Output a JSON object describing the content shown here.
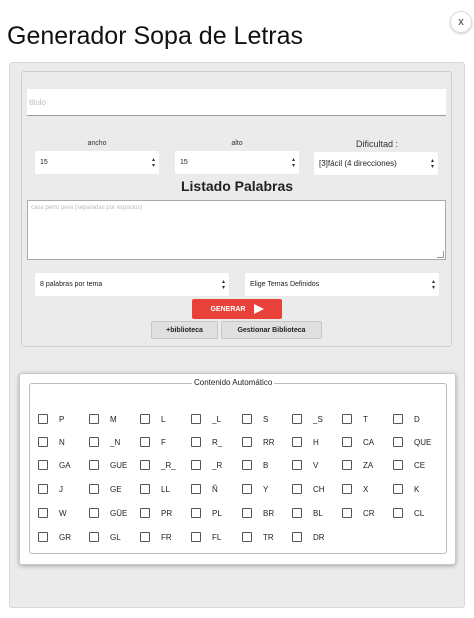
{
  "window": {
    "close_label": "x"
  },
  "page_title": "Generador Sopa de Letras",
  "form": {
    "title_placeholder": "titulo",
    "ancho_label": "ancho",
    "alto_label": "alto",
    "dificultad_label": "Dificultad :",
    "ancho_value": "15",
    "alto_value": "15",
    "dificultad_value": "[3]fácil (4 direcciones)",
    "listado_title": "Listado Palabras",
    "words_placeholder": "casa perro pera (separadas por espacios)",
    "palabras_por_tema": "8 palabras por tema",
    "temas_value": "Elige Temas Definidos",
    "generar_label": "GENERAR",
    "biblioteca_label": "+biblioteca",
    "gestionar_label": "Gestionar Biblioteca"
  },
  "contenido": {
    "legend": "Contenido Automático",
    "items": [
      "P",
      "M",
      "L",
      "_L",
      "S",
      "_S",
      "T",
      "D",
      "N",
      "_N",
      "F",
      "R_",
      "RR",
      "H",
      "CA",
      "QUE",
      "GA",
      "GUE",
      "_R_",
      "_R",
      "B",
      "V",
      "ZA",
      "CE",
      "J",
      "GE",
      "LL",
      "Ñ",
      "Y",
      "CH",
      "X",
      "K",
      "W",
      "GÜE",
      "PR",
      "PL",
      "BR",
      "BL",
      "CR",
      "CL",
      "GR",
      "GL",
      "FR",
      "FL",
      "TR",
      "DR"
    ]
  },
  "colors": {
    "accent": "#e8413a",
    "panel": "#ebebeb"
  }
}
